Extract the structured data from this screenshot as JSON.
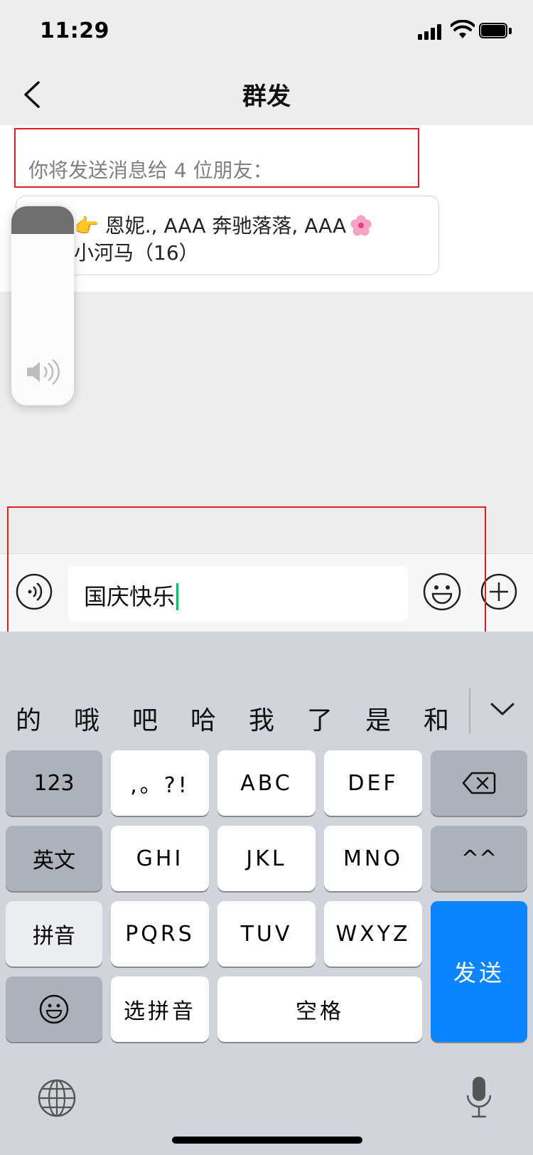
{
  "status_bar": {
    "time": "11:29"
  },
  "nav": {
    "title": "群发"
  },
  "recipients": {
    "label": "你将发送消息给 4 位朋友：",
    "line1": "👉 恩妮., AAA 奔驰落落, AAA",
    "line2": "小河马（16）"
  },
  "volume_hud": {
    "level": 0.14
  },
  "input_bar": {
    "text": "国庆快乐"
  },
  "keyboard": {
    "candidates": [
      "的",
      "哦",
      "吧",
      "哈",
      "我",
      "了",
      "是",
      "和"
    ],
    "rows": {
      "r1": [
        "123",
        ",。?!",
        "ABC",
        "DEF"
      ],
      "r2": [
        "英文",
        "GHI",
        "JKL",
        "MNO",
        "^^"
      ],
      "r3": [
        "拼音",
        "PQRS",
        "TUV",
        "WXYZ"
      ],
      "r4": [
        "选拼音",
        "空格"
      ],
      "send": "发送"
    }
  },
  "colors": {
    "accent_green": "#07c160",
    "send_blue": "#0a84ff",
    "highlight_red": "#e02020"
  },
  "icons": [
    "back-icon",
    "signal-icon",
    "wifi-icon",
    "battery-icon",
    "speaker-icon",
    "voice-input-icon",
    "emoji-icon",
    "plus-icon",
    "backspace-icon",
    "emoji-key-icon",
    "globe-icon",
    "microphone-icon",
    "chevron-down-icon",
    "flower-icon"
  ]
}
